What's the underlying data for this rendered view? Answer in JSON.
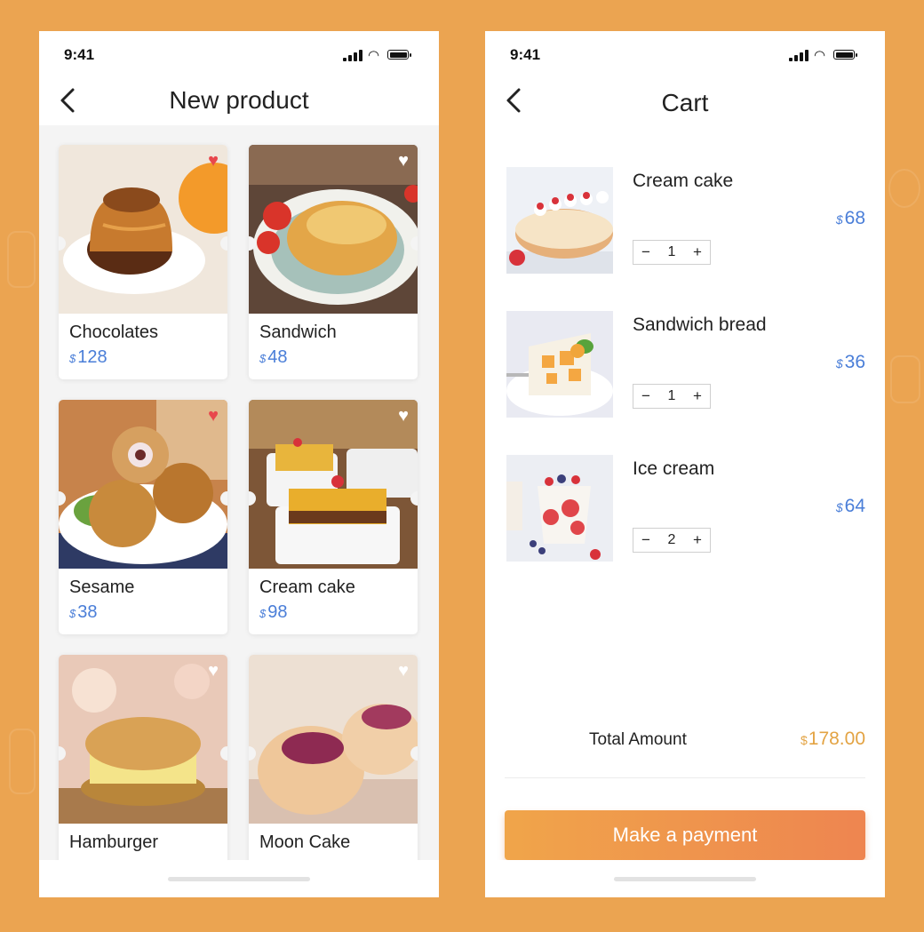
{
  "colors": {
    "background": "#eba451",
    "price_blue": "#4a7ed8",
    "total_gold": "#e3a343",
    "button_gradient_start": "#f0a54a",
    "button_gradient_end": "#ee8550",
    "heart_active": "#e8474c",
    "heart_inactive": "#ffffff"
  },
  "status_bar": {
    "time": "9:41",
    "icons": [
      "signal-icon",
      "wifi-icon",
      "battery-icon"
    ]
  },
  "left_screen": {
    "back_icon": "chevron-left-icon",
    "title": "New product",
    "currency": "$",
    "products": [
      {
        "name": "Chocolates",
        "price": "128",
        "favorited": true
      },
      {
        "name": "Sandwich",
        "price": "48",
        "favorited": false
      },
      {
        "name": "Sesame",
        "price": "38",
        "favorited": true
      },
      {
        "name": "Cream cake",
        "price": "98",
        "favorited": false
      },
      {
        "name": "Hamburger",
        "price": "",
        "favorited": false
      },
      {
        "name": "Moon Cake",
        "price": "",
        "favorited": false
      }
    ]
  },
  "right_screen": {
    "back_icon": "chevron-left-icon",
    "title": "Cart",
    "currency": "$",
    "qty_minus": "−",
    "qty_plus": "+",
    "items": [
      {
        "name": "Cream cake",
        "price": "68",
        "quantity": "1"
      },
      {
        "name": "Sandwich bread",
        "price": "36",
        "quantity": "1"
      },
      {
        "name": "Ice cream",
        "price": "64",
        "quantity": "2"
      }
    ],
    "total_label": "Total Amount",
    "total_value": "178.00",
    "pay_button": "Make a payment"
  }
}
